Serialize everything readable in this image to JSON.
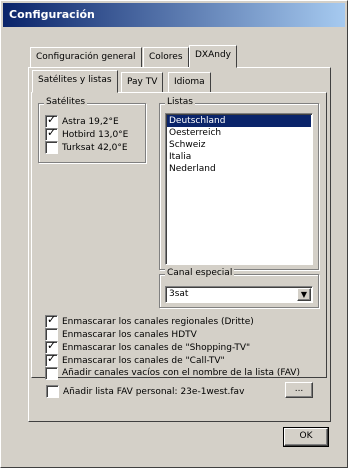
{
  "window": {
    "title": "Configuración"
  },
  "tabs": [
    {
      "label": "Configuración general",
      "active": false
    },
    {
      "label": "Colores",
      "active": false
    },
    {
      "label": "DXAndy",
      "active": true
    }
  ],
  "subtabs": [
    {
      "label": "Satélites y listas",
      "active": true
    },
    {
      "label": "Pay TV",
      "active": false
    },
    {
      "label": "Idioma",
      "active": false
    }
  ],
  "satellites": {
    "legend": "Satélites",
    "items": [
      {
        "label": "Astra 19,2°E",
        "checked": true
      },
      {
        "label": "Hotbird 13,0°E",
        "checked": true
      },
      {
        "label": "Turksat 42,0°E",
        "checked": false
      }
    ]
  },
  "lists": {
    "legend": "Listas",
    "items": [
      {
        "label": "Deutschland",
        "selected": true
      },
      {
        "label": "Oesterreich",
        "selected": false
      },
      {
        "label": "Schweiz",
        "selected": false
      },
      {
        "label": "Italia",
        "selected": false
      },
      {
        "label": "Nederland",
        "selected": false
      }
    ]
  },
  "special_channel": {
    "legend": "Canal especial",
    "value": "3sat"
  },
  "options": [
    {
      "label": "Enmascarar los canales regionales (Dritte)",
      "checked": true
    },
    {
      "label": "Enmascarar los canales HDTV",
      "checked": false
    },
    {
      "label": "Enmascarar los canales de \"Shopping-TV\"",
      "checked": true
    },
    {
      "label": "Enmascarar los canales de \"Call-TV\"",
      "checked": true
    },
    {
      "label": "Añadir canales vacíos con el nombre de la lista (FAV)",
      "checked": false
    },
    {
      "label": "Añadir lista FAV personal: 23e-1west.fav",
      "checked": false
    }
  ],
  "browse_button": "...",
  "ok_button": "OK"
}
